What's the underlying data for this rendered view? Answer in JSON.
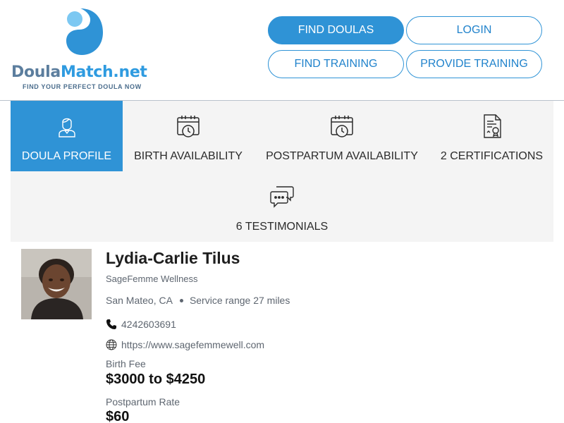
{
  "brand": {
    "name_part1": "Doula",
    "name_part2": "Match.net",
    "tagline": "FIND YOUR PERFECT DOULA NOW",
    "logo_icon": "yin-yang-drop-icon",
    "colors": {
      "primary": "#2f93d6",
      "logo_gray": "#5c7e9e",
      "logo_blue": "#2f9be0"
    }
  },
  "nav": {
    "find_doulas": "FIND DOULAS",
    "login": "LOGIN",
    "find_training": "FIND TRAINING",
    "provide_training": "PROVIDE TRAINING"
  },
  "tabs": [
    {
      "label": "DOULA PROFILE",
      "icon": "doula-person-icon",
      "active": true
    },
    {
      "label": "BIRTH AVAILABILITY",
      "icon": "calendar-clock-icon",
      "active": false
    },
    {
      "label": "POSTPARTUM AVAILABILITY",
      "icon": "calendar-clock-icon",
      "active": false
    },
    {
      "label": "2 CERTIFICATIONS",
      "icon": "certificate-icon",
      "active": false
    },
    {
      "label": "6 TESTIMONIALS",
      "icon": "chat-bubbles-icon",
      "active": false
    }
  ],
  "profile": {
    "name": "Lydia-Carlie Tilus",
    "organization": "SageFemme Wellness",
    "location": "San Mateo, CA",
    "service_range": "Service range 27 miles",
    "phone": "4242603691",
    "website": "https://www.sagefemmewell.com",
    "birth_fee_label": "Birth Fee",
    "birth_fee": "$3000 to $4250",
    "postpartum_rate_label": "Postpartum Rate",
    "postpartum_rate": "$60"
  }
}
